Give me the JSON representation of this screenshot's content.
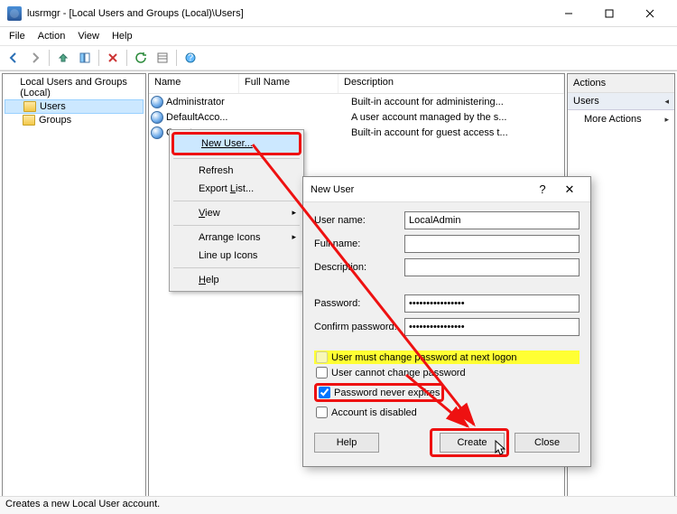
{
  "window": {
    "title": "lusrmgr - [Local Users and Groups (Local)\\Users]"
  },
  "menubar": {
    "file": "File",
    "action": "Action",
    "view": "View",
    "help": "Help"
  },
  "tree": {
    "root": "Local Users and Groups (Local)",
    "users": "Users",
    "groups": "Groups"
  },
  "list": {
    "cols": {
      "name": "Name",
      "full": "Full Name",
      "desc": "Description"
    },
    "rows": [
      {
        "name": "Administrator",
        "full": "",
        "desc": "Built-in account for administering..."
      },
      {
        "name": "DefaultAcco...",
        "full": "",
        "desc": "A user account managed by the s..."
      },
      {
        "name": "Guest",
        "full": "",
        "desc": "Built-in account for guest access t..."
      }
    ]
  },
  "actions": {
    "header": "Actions",
    "sub": "Users",
    "more": "More Actions"
  },
  "context": {
    "new_user": "New User...",
    "refresh": "Refresh",
    "export": "Export List...",
    "view": "View",
    "arrange": "Arrange Icons",
    "lineup": "Line up Icons",
    "help": "Help"
  },
  "dialog": {
    "title": "New User",
    "labels": {
      "username": "User name:",
      "fullname": "Full name:",
      "description": "Description:",
      "password": "Password:",
      "confirm": "Confirm password:"
    },
    "values": {
      "username": "LocalAdmin",
      "fullname": "",
      "description": "",
      "password": "••••••••••••••••",
      "confirm": "••••••••••••••••"
    },
    "checks": {
      "must_change": "User must change password at next logon",
      "cannot_change": "User cannot change password",
      "never_expires": "Password never expires",
      "disabled": "Account is disabled"
    },
    "buttons": {
      "help": "Help",
      "create": "Create",
      "close": "Close"
    }
  },
  "status": "Creates a new Local User account."
}
